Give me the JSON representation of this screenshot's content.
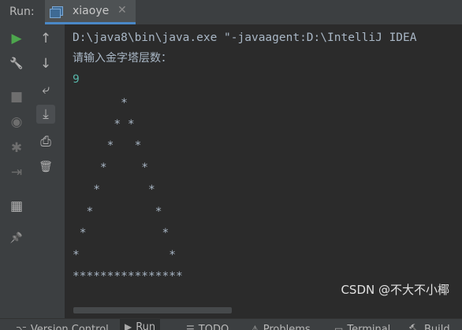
{
  "header": {
    "run_label": "Run:",
    "tab_title": "xiaoye",
    "tab_close": "✕"
  },
  "toolbar": {
    "col1": [
      {
        "name": "rerun-icon",
        "glyph": "▶",
        "color": "#4da64d"
      },
      {
        "name": "wrench-icon",
        "glyph": "🔧"
      },
      {
        "name": "stop-icon",
        "glyph": "■"
      },
      {
        "name": "camera-icon",
        "glyph": "◉"
      },
      {
        "name": "bug-icon",
        "glyph": "✱"
      },
      {
        "name": "login-icon",
        "glyph": "⇥"
      },
      {
        "name": "layout-icon",
        "glyph": "▦"
      },
      {
        "name": "pin-icon",
        "glyph": "📌"
      }
    ],
    "col2": [
      {
        "name": "arrow-up-icon",
        "glyph": "↑"
      },
      {
        "name": "arrow-down-icon",
        "glyph": "↓"
      },
      {
        "name": "soft-wrap-icon",
        "glyph": "⤶"
      },
      {
        "name": "scroll-to-end-icon",
        "glyph": "⤓"
      },
      {
        "name": "print-icon",
        "glyph": "⎙"
      },
      {
        "name": "trash-icon",
        "glyph": "🗑"
      }
    ]
  },
  "console": {
    "command": "D:\\java8\\bin\\java.exe \"-javaagent:D:\\IntelliJ IDEA",
    "prompt": "请输入金字塔层数：",
    "input": "9",
    "pyramid": [
      "       *",
      "      * *",
      "     *   *",
      "    *     *",
      "   *       *",
      "  *         *",
      " *           *",
      "*             *",
      "****************"
    ]
  },
  "watermark": "CSDN @不大不小椰",
  "bottombar": [
    {
      "icon": "⌥",
      "label": "Version Control"
    },
    {
      "icon": "▶",
      "label": "Run"
    },
    {
      "icon": "☰",
      "label": "TODO"
    },
    {
      "icon": "⚠",
      "label": "Problems"
    },
    {
      "icon": "▭",
      "label": "Terminal"
    },
    {
      "icon": "🔨",
      "label": "Build"
    }
  ]
}
